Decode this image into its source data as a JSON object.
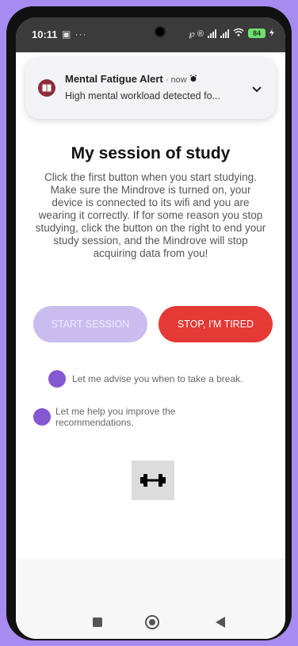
{
  "status_bar": {
    "time": "10:11",
    "left_icons": "▣ ···",
    "right_icons": "℘ ®",
    "battery": "84"
  },
  "notification": {
    "title": "Mental Fatigue Alert",
    "meta": " · now ",
    "text": "High mental workload detected fo..."
  },
  "main": {
    "title": "My session of study",
    "description": "Click the first button when you start studying. Make sure the Mindrove is turned on, your device is connected to its wifi and you are wearing it correctly. If for some reason you stop studying, click the button on the right to end your study session, and the Mindrove will stop acquiring data from you!",
    "start_button": "START SESSION",
    "stop_button": "STOP, I'M TIRED",
    "option_break": "Let me advise you when to take a break.",
    "option_improve": "Let me help you improve the recommendations."
  },
  "colors": {
    "accent": "#8458d0",
    "stop": "#e53935",
    "start_disabled": "#cbbcef",
    "background": "#a78bf0"
  },
  "icons": {
    "notification_app": "book-icon",
    "notification_expand": "chevron-down-icon",
    "exercise_button": "dumbbell-icon",
    "nav_recents": "square-icon",
    "nav_home": "circle-icon",
    "nav_back": "triangle-back-icon"
  }
}
